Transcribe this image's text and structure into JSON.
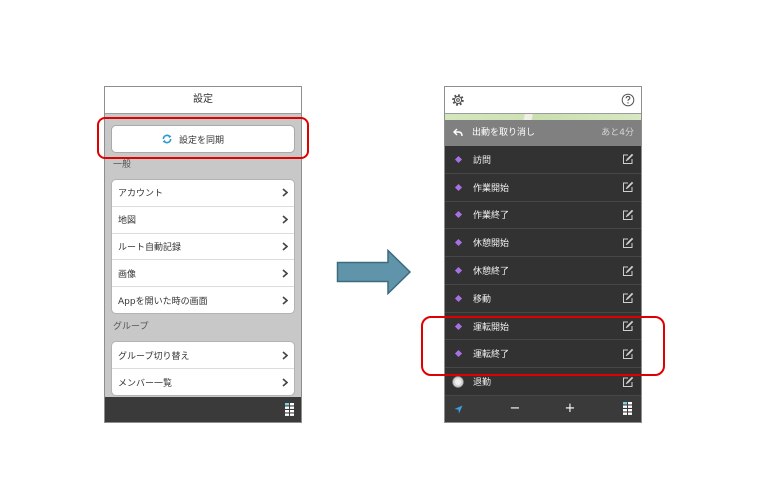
{
  "left_screen": {
    "title": "設定",
    "sync_button": {
      "label": "設定を同期",
      "icon": "sync-icon",
      "highlighted": true
    },
    "sections": [
      {
        "label": "一般",
        "items": [
          "アカウント",
          "地図",
          "ルート自動記録",
          "画像",
          "Appを開いた時の画面"
        ]
      },
      {
        "label": "グループ",
        "items": [
          "グループ切り替え",
          "メンバー一覧"
        ]
      }
    ],
    "toolbar": {
      "right_icon": "grid-icon"
    }
  },
  "right_screen": {
    "header": {
      "left_icon": "gear-icon",
      "right_icon": "help-icon"
    },
    "undo_bar": {
      "label": "出動を取り消し",
      "remaining": "あと4分",
      "icon": "back-arrow-icon"
    },
    "actions": [
      {
        "label": "訪問",
        "icon": "diamond-icon",
        "highlighted": false
      },
      {
        "label": "作業開始",
        "icon": "diamond-icon",
        "highlighted": false
      },
      {
        "label": "作業終了",
        "icon": "diamond-icon",
        "highlighted": false
      },
      {
        "label": "休憩開始",
        "icon": "diamond-icon",
        "highlighted": false
      },
      {
        "label": "休憩終了",
        "icon": "diamond-icon",
        "highlighted": false
      },
      {
        "label": "移動",
        "icon": "diamond-icon",
        "highlighted": false
      },
      {
        "label": "運転開始",
        "icon": "diamond-icon",
        "highlighted": true
      },
      {
        "label": "運転終了",
        "icon": "diamond-icon",
        "highlighted": true
      },
      {
        "label": "退勤",
        "icon": "circle-icon",
        "highlighted": false
      }
    ],
    "toolbar": {
      "left_icon": "location-arrow-icon",
      "zoom_out": "−",
      "zoom_in": "+",
      "right_icon": "grid-icon"
    }
  },
  "colors": {
    "highlight": "#e00000",
    "action_diamond": "#a870e4",
    "sync_icon": "#2e9ad0",
    "location_icon": "#3aa0e0",
    "transition_arrow": "#5f94aa",
    "list_dark_bg": "#323232",
    "toolbar_bg": "#3a3a3a",
    "undo_bar_bg": "#808080",
    "settings_bg": "#c8c8c8"
  }
}
